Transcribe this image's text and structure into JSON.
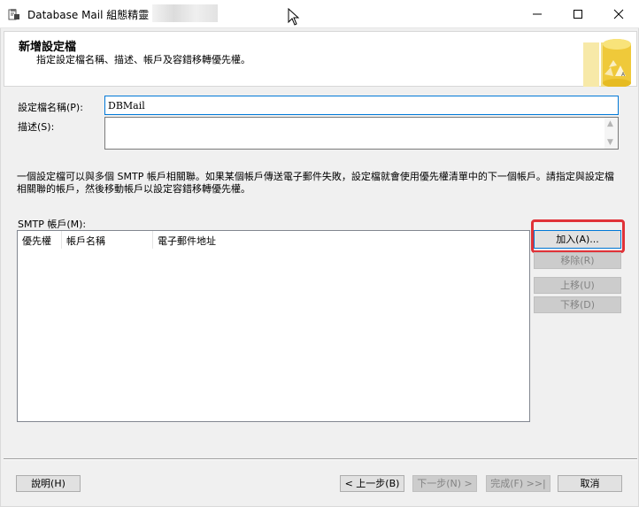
{
  "window": {
    "title": "Database Mail 組態精靈 -",
    "minimize_icon": "minimize-icon",
    "maximize_icon": "maximize-icon",
    "close_icon": "close-icon"
  },
  "header": {
    "title": "新增設定檔",
    "subtitle": "指定設定檔名稱、描述、帳戶及容錯移轉優先權。"
  },
  "form": {
    "profile_name_label": "設定檔名稱(P):",
    "profile_name_value": "DBMail",
    "description_label": "描述(S):",
    "description_value": ""
  },
  "info_text": "一個設定檔可以與多個 SMTP 帳戶相關聯。如果某個帳戶傳送電子郵件失敗，設定檔就會使用優先權清單中的下一個帳戶。請指定與設定檔相關聯的帳戶，然後移動帳戶以設定容錯移轉優先權。",
  "accounts": {
    "label": "SMTP 帳戶(M):",
    "columns": [
      "優先權",
      "帳戶名稱",
      "電子郵件地址"
    ],
    "rows": []
  },
  "side_buttons": {
    "add": "加入(A)...",
    "remove": "移除(R)",
    "move_up": "上移(U)",
    "move_down": "下移(D)"
  },
  "footer": {
    "help": "說明(H)",
    "back": "< 上一步(B)",
    "next": "下一步(N) >",
    "finish": "完成(F) >>|",
    "cancel": "取消"
  },
  "colors": {
    "highlight_box": "#e03238",
    "focus_border": "#0078d7"
  }
}
